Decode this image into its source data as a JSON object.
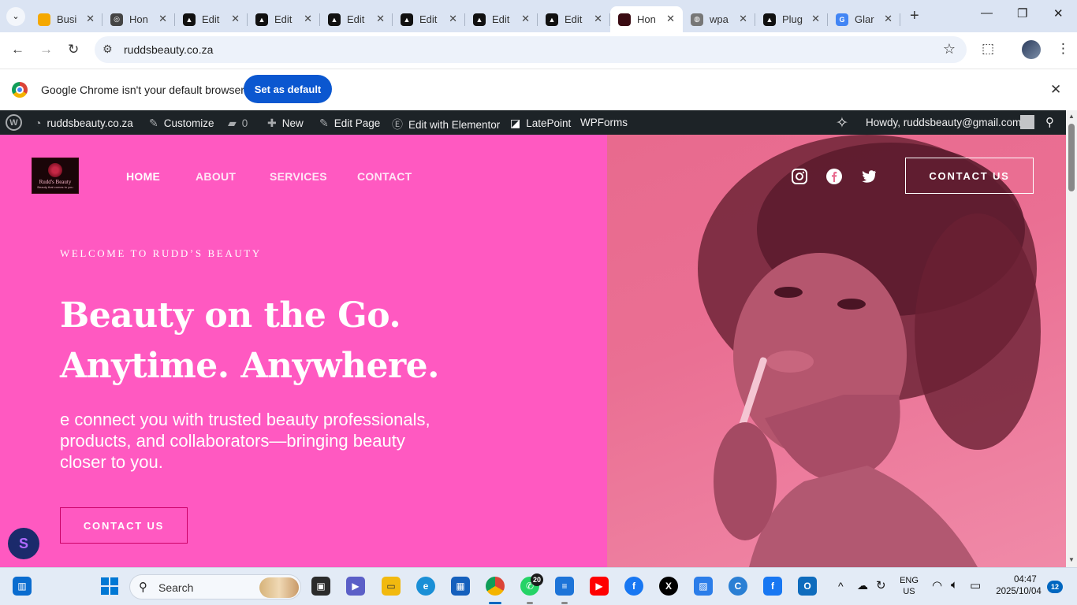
{
  "browser": {
    "tabs": [
      {
        "title": "Busi",
        "fav_color": "#f5a800",
        "fav_glyph": ""
      },
      {
        "title": "Hon",
        "fav_color": "#444444",
        "fav_glyph": "◎"
      },
      {
        "title": "Edit",
        "fav_color": "#111111",
        "fav_glyph": "▲"
      },
      {
        "title": "Edit",
        "fav_color": "#111111",
        "fav_glyph": "▲"
      },
      {
        "title": "Edit",
        "fav_color": "#111111",
        "fav_glyph": "▲"
      },
      {
        "title": "Edit",
        "fav_color": "#111111",
        "fav_glyph": "▲"
      },
      {
        "title": "Edit",
        "fav_color": "#111111",
        "fav_glyph": "▲"
      },
      {
        "title": "Edit",
        "fav_color": "#111111",
        "fav_glyph": "▲"
      },
      {
        "title": "Hon",
        "fav_color": "#3a0b12",
        "fav_glyph": "",
        "active": true
      },
      {
        "title": "wpa",
        "fav_color": "#777777",
        "fav_glyph": "◍"
      },
      {
        "title": "Plug",
        "fav_color": "#111111",
        "fav_glyph": "▲"
      },
      {
        "title": "Glar",
        "fav_color": "#4285f4",
        "fav_glyph": "G"
      }
    ],
    "url": "ruddsbeauty.co.za",
    "infobar_text": "Google Chrome isn't your default browser",
    "set_default_label": "Set as default"
  },
  "wpbar": {
    "site": "ruddsbeauty.co.za",
    "customize": "Customize",
    "comments_count": "0",
    "new": "New",
    "edit_page": "Edit Page",
    "edit_elementor": "Edit with Elementor",
    "latepoint": "LatePoint",
    "wpforms": "WPForms",
    "howdy": "Howdy, ruddsbeauty@gmail.com"
  },
  "site": {
    "logo_name": "Rudd's Beauty",
    "logo_tag": "Beauty that comes to you",
    "nav": {
      "home": "HOME",
      "about": "ABOUT",
      "services": "SERVICES",
      "contact": "CONTACT"
    },
    "cta_header": "CONTACT US",
    "eyebrow": "WELCOME TO RUDD’S BEAUTY",
    "headline_line1": "Beauty on the Go.",
    "headline_line2": "Anytime. Anywhere.",
    "subtext": "e connect you with trusted beauty professionals, products, and collaborators—bringing beauty closer to you.",
    "cta_hero": "CONTACT US",
    "colors": {
      "left_bg": "#ff59c1",
      "right_bg": "#ea6f93",
      "cta_border": "#cc0066"
    }
  },
  "taskbar": {
    "search_label": "Search",
    "whatsapp_badge": "20",
    "lang_line1": "ENG",
    "lang_line2": "US",
    "time": "04:47",
    "date": "2025/10/04",
    "notif_count": "12"
  }
}
